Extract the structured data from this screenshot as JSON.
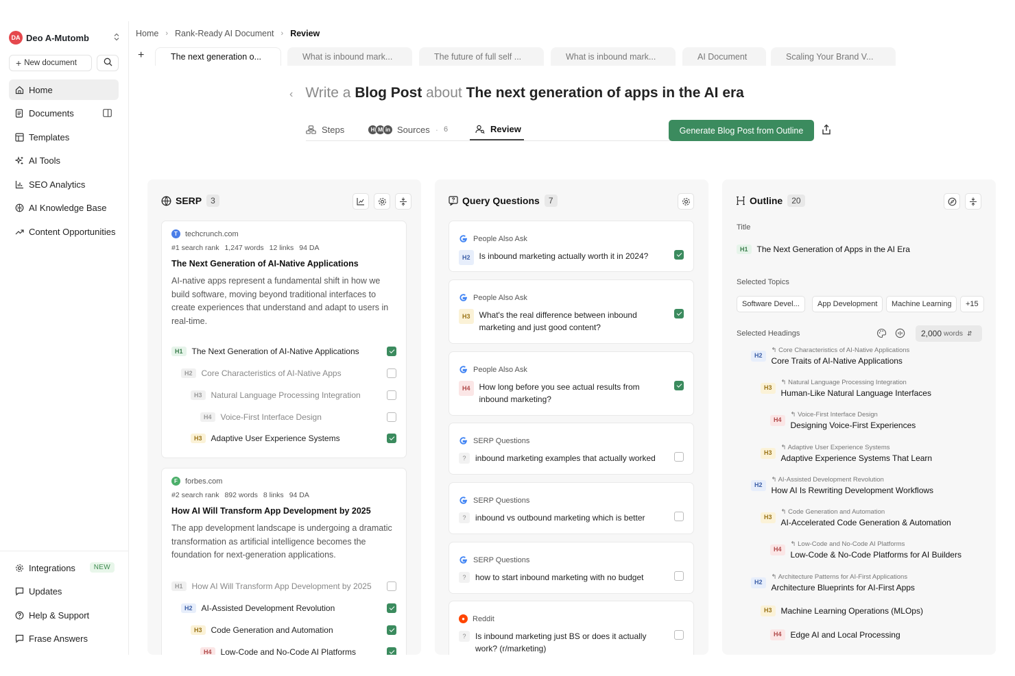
{
  "user": {
    "initials": "DA",
    "name": "Deo A-Mutomb"
  },
  "sidebar": {
    "new_document": "New document",
    "items": [
      {
        "label": "Home"
      },
      {
        "label": "Documents"
      },
      {
        "label": "Templates"
      },
      {
        "label": "AI Tools"
      },
      {
        "label": "SEO Analytics"
      },
      {
        "label": "AI Knowledge Base"
      },
      {
        "label": "Content Opportunities"
      }
    ],
    "bottom_items": [
      {
        "label": "Integrations",
        "badge": "NEW"
      },
      {
        "label": "Updates"
      },
      {
        "label": "Help & Support"
      },
      {
        "label": "Frase Answers"
      }
    ]
  },
  "breadcrumb": [
    "Home",
    "Rank-Ready AI Document",
    "Review"
  ],
  "tabs": [
    "The next generation o...",
    "What is inbound mark...",
    "The future of full self ...",
    "What is inbound mark...",
    "AI Document",
    "Scaling Your Brand V..."
  ],
  "header": {
    "write": "Write a",
    "type": "Blog Post",
    "about": "about",
    "topic": "The next generation of apps in the AI era"
  },
  "subtabs": {
    "steps": "Steps",
    "sources": "Sources",
    "sources_count": "6",
    "sources_avatars": [
      "H",
      "M",
      "in"
    ],
    "review": "Review"
  },
  "generate_button": "Generate Blog Post from Outline",
  "serp": {
    "title": "SERP",
    "count": "3",
    "results": [
      {
        "domain": "techcrunch.com",
        "rank": "#1 search rank",
        "words": "1,247 words",
        "links": "12 links",
        "da": "94 DA",
        "title": "The Next Generation of AI-Native Applications",
        "desc": "AI-native apps represent a fundamental shift in how we build software, moving beyond traditional interfaces to create experiences that understand and adapt to users in real-time.",
        "headings": [
          {
            "tag": "H1",
            "text": "The Next Generation of AI-Native Applications",
            "checked": true
          },
          {
            "tag": "H2",
            "text": "Core Characteristics of AI-Native Apps",
            "checked": false
          },
          {
            "tag": "H3",
            "text": "Natural Language Processing Integration",
            "checked": false
          },
          {
            "tag": "H4",
            "text": "Voice-First Interface Design",
            "checked": false
          },
          {
            "tag": "H3",
            "text": "Adaptive User Experience Systems",
            "checked": true
          }
        ]
      },
      {
        "domain": "forbes.com",
        "rank": "#2 search rank",
        "words": "892 words",
        "links": "8 links",
        "da": "94 DA",
        "title": "How AI Will Transform App Development by 2025",
        "desc": "The app development landscape is undergoing a dramatic transformation as artificial intelligence becomes the foundation for next-generation applications.",
        "headings": [
          {
            "tag": "H1",
            "text": "How AI Will Transform App Development by 2025",
            "checked": false
          },
          {
            "tag": "H2",
            "text": "AI-Assisted Development Revolution",
            "checked": true
          },
          {
            "tag": "H3",
            "text": "Code Generation and Automation",
            "checked": true
          },
          {
            "tag": "H4",
            "text": "Low-Code and No-Code AI Platforms",
            "checked": true
          }
        ]
      }
    ]
  },
  "questions": {
    "title": "Query Questions",
    "count": "7",
    "items": [
      {
        "source": "People Also Ask",
        "tag": "H2",
        "text": "Is inbound marketing actually worth it in 2024?",
        "checked": true
      },
      {
        "source": "People Also Ask",
        "tag": "H3",
        "text": "What's the real difference between inbound marketing and just good content?",
        "checked": true
      },
      {
        "source": "People Also Ask",
        "tag": "H4",
        "text": "How long before you see actual results from inbound marketing?",
        "checked": true
      },
      {
        "source": "SERP Questions",
        "tag": "?",
        "text": "inbound marketing examples that actually worked",
        "checked": false
      },
      {
        "source": "SERP Questions",
        "tag": "?",
        "text": "inbound vs outbound marketing which is better",
        "checked": false
      },
      {
        "source": "SERP Questions",
        "tag": "?",
        "text": "how to start inbound marketing with no budget",
        "checked": false
      },
      {
        "source": "Reddit",
        "tag": "?",
        "text": "Is inbound marketing just BS or does it actually work? (r/marketing)",
        "checked": false
      }
    ]
  },
  "outline": {
    "title": "Outline",
    "count": "20",
    "title_label": "Title",
    "title_tag": "H1",
    "title_text": "The Next Generation of Apps in the AI Era",
    "topics_label": "Selected Topics",
    "topics": [
      "Software Devel...",
      "App Development",
      "Machine Learning",
      "+15"
    ],
    "headings_label": "Selected Headings",
    "words_value": "2,000",
    "words_unit": "words",
    "items": [
      {
        "tag": "H2",
        "source": "Core Characteristics of AI-Native Applications",
        "text": "Core Traits of AI-Native Applications"
      },
      {
        "tag": "H3",
        "source": "Natural Language Processing Integration",
        "text": "Human-Like Natural Language Interfaces"
      },
      {
        "tag": "H4",
        "source": "Voice-First Interface Design",
        "text": "Designing Voice-First Experiences"
      },
      {
        "tag": "H3",
        "source": "Adaptive User Experience Systems",
        "text": "Adaptive Experience Systems That Learn"
      },
      {
        "tag": "H2",
        "source": "AI-Assisted Development Revolution",
        "text": "How AI Is Rewriting Development Workflows"
      },
      {
        "tag": "H3",
        "source": "Code Generation and Automation",
        "text": "AI-Accelerated Code Generation & Automation"
      },
      {
        "tag": "H4",
        "source": "Low-Code and No-Code AI Platforms",
        "text": "Low-Code & No-Code Platforms for AI Builders"
      },
      {
        "tag": "H2",
        "source": "Architecture Patterns for AI-First Applications",
        "text": "Architecture Blueprints for AI-First Apps"
      },
      {
        "tag": "H3",
        "source": "",
        "text": "Machine Learning Operations (MLOps)"
      },
      {
        "tag": "H4",
        "source": "",
        "text": "Edge AI and Local Processing"
      }
    ]
  },
  "colors": {
    "accent": "#3b8b5e",
    "avatar": "#e5484d"
  }
}
